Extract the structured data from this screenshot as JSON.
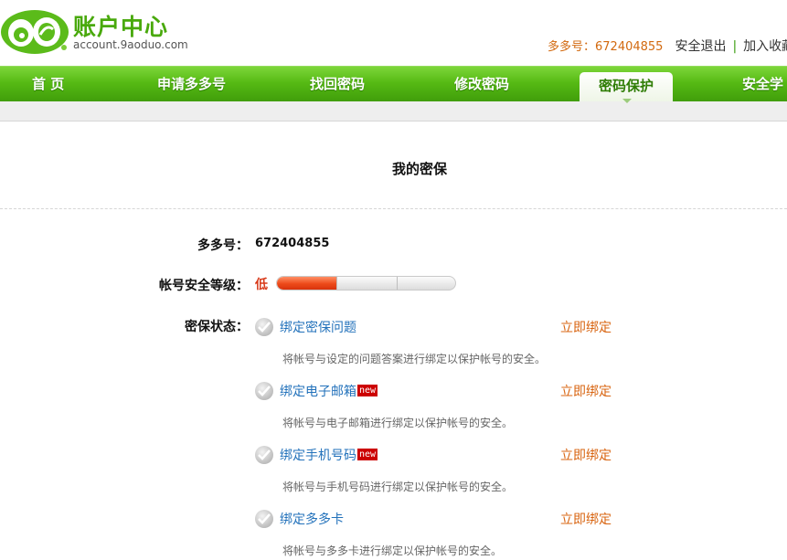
{
  "header": {
    "logo_title": "账户中心",
    "logo_domain": "account.9aoduo.com",
    "account_label": "多多号：672404855",
    "logout": "安全退出",
    "separator": "|",
    "bookmark": "加入收藏"
  },
  "nav": {
    "items": [
      "首 页",
      "申请多多号",
      "找回密码",
      "修改密码",
      "密码保护",
      "安全学"
    ],
    "active": "密码保护"
  },
  "main": {
    "title": "我的密保",
    "account_label": "多多号：",
    "account_value": "672404855",
    "level_label": "帐号安全等级：",
    "level_value": "低",
    "level_fraction": 0.34,
    "level_segments": 3,
    "level_color": "#ed4a1a",
    "status_label": "密保状态：",
    "new_badge": "new",
    "items": [
      {
        "title": "绑定密保问题",
        "new": false,
        "desc": "将帐号与设定的问题答案进行绑定以保护帐号的安全。",
        "action": "立即绑定"
      },
      {
        "title": "绑定电子邮箱",
        "new": true,
        "desc": "将帐号与电子邮箱进行绑定以保护帐号的安全。",
        "action": "立即绑定"
      },
      {
        "title": "绑定手机号码",
        "new": true,
        "desc": "将帐号与手机号码进行绑定以保护帐号的安全。",
        "action": "立即绑定"
      },
      {
        "title": "绑定多多卡",
        "new": false,
        "desc": "将帐号与多多卡进行绑定以保护帐号的安全。",
        "action": "立即绑定"
      }
    ]
  },
  "icons": {
    "logo": "9-sixty-logo-icon",
    "check": "check-circle-icon"
  }
}
